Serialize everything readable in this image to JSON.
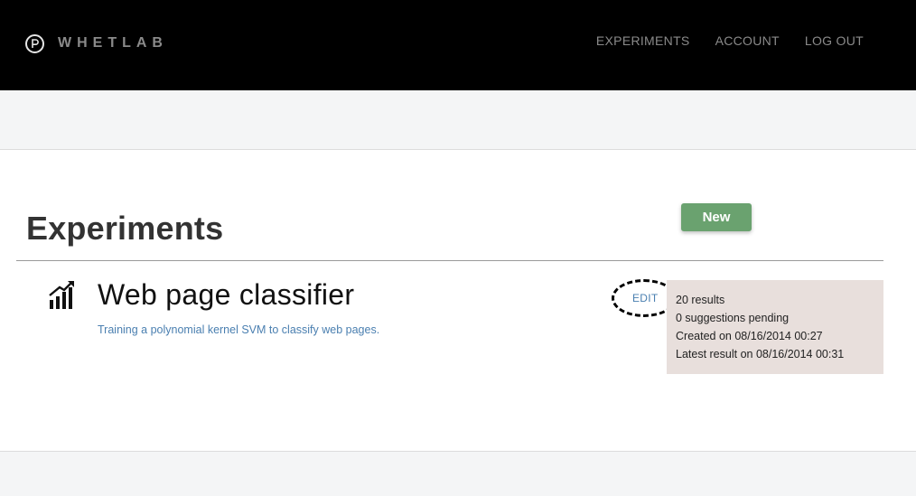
{
  "header": {
    "brand": "WHETLAB",
    "logo_letter": "P",
    "nav": [
      {
        "label": "EXPERIMENTS"
      },
      {
        "label": "ACCOUNT"
      },
      {
        "label": "LOG OUT"
      }
    ]
  },
  "main": {
    "title": "Experiments",
    "new_button": "New",
    "experiments": [
      {
        "icon": "bar-chart-trend-icon",
        "name": "Web page classifier",
        "description": "Training a polynomial kernel SVM to classify web pages.",
        "edit_label": "EDIT",
        "stats": [
          "20 results",
          "0 suggestions pending",
          "Created on 08/16/2014 00:27",
          "Latest result on 08/16/2014 00:31"
        ]
      }
    ]
  },
  "colors": {
    "topbar": "#000000",
    "new_button": "#6aa26f",
    "link": "#4a7fb0",
    "stats_bg": "#e8dfdc"
  }
}
